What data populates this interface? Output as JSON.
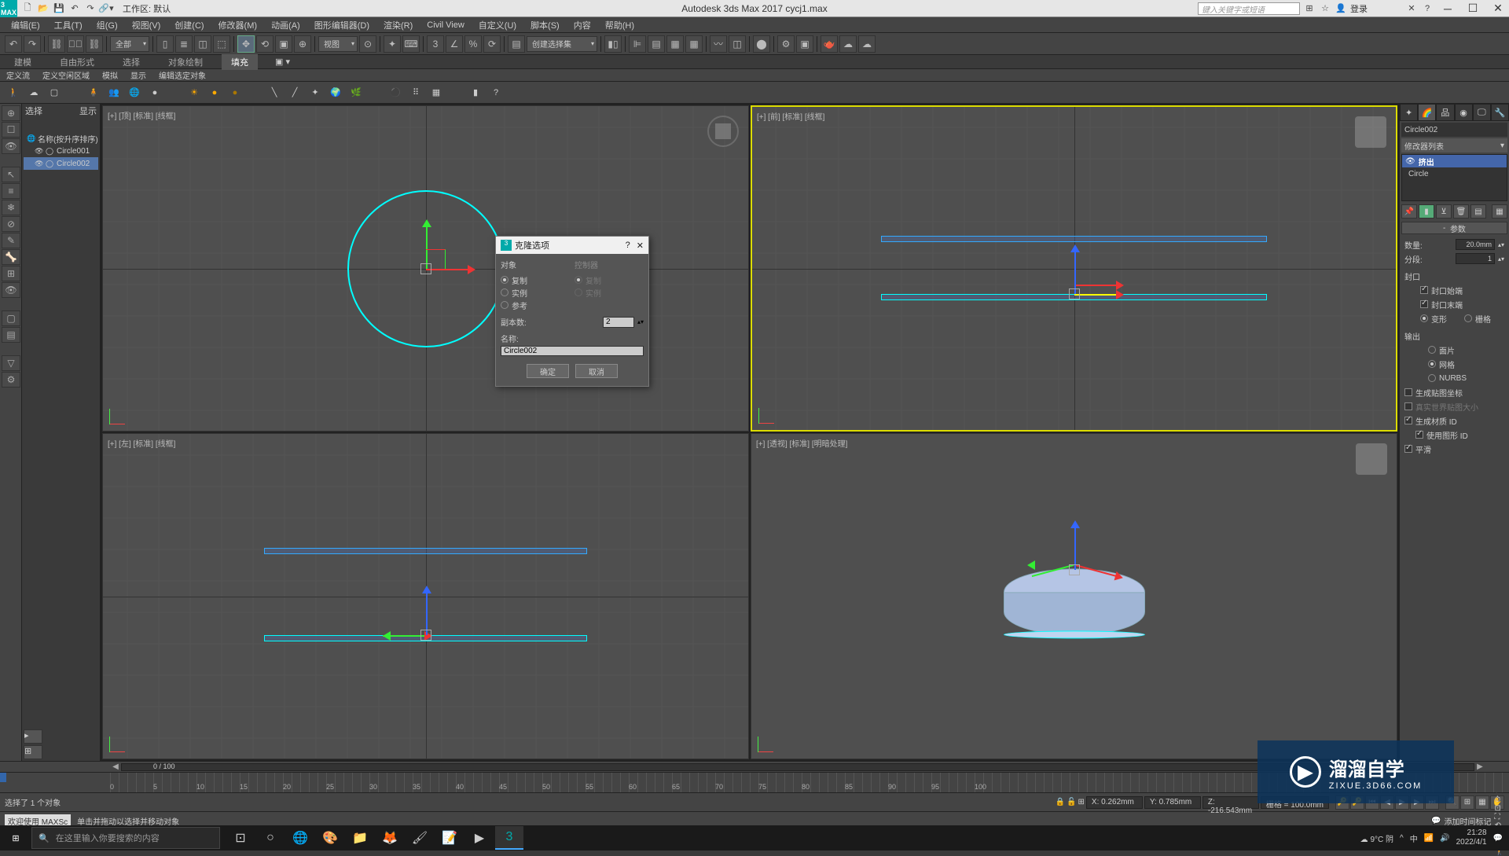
{
  "title": "Autodesk 3ds Max 2017   cycj1.max",
  "workspace": "工作区: 默认",
  "search_placeholder": "键入关键字或短语",
  "login": "登录",
  "menu": [
    "编辑(E)",
    "工具(T)",
    "组(G)",
    "视图(V)",
    "创建(C)",
    "修改器(M)",
    "动画(A)",
    "图形编辑器(D)",
    "渲染(R)",
    "Civil View",
    "自定义(U)",
    "脚本(S)",
    "内容",
    "帮助(H)"
  ],
  "toolbar_combo1": "全部",
  "toolbar_combo2": "视图",
  "toolbar_combo3": "创建选择集",
  "ribbon_tabs": [
    "建模",
    "自由形式",
    "选择",
    "对象绘制",
    "填充"
  ],
  "sub_tabs": [
    "定义流",
    "定义空闲区域",
    "模拟",
    "显示",
    "编辑选定对象"
  ],
  "scene_explorer": {
    "header_toggle": "选择",
    "header_display": "显示",
    "sort_label": "名称(按升序排序)",
    "nodes": [
      "Circle001",
      "Circle002"
    ]
  },
  "viewports": {
    "top": "[+] [顶] [标准] [线框]",
    "front": "[+] [前] [标准] [线框]",
    "left": "[+] [左] [标准] [线框]",
    "persp": "[+] [透视] [标准] [明暗处理]"
  },
  "dialog": {
    "title": "克隆选项",
    "object_label": "对象",
    "controller_label": "控制器",
    "copy": "复制",
    "instance": "实例",
    "reference": "参考",
    "copies_label": "副本数:",
    "copies_value": "2",
    "name_label": "名称:",
    "name_value": "Circle002",
    "ok": "确定",
    "cancel": "取消"
  },
  "cmdpanel": {
    "objname": "Circle002",
    "modlist_label": "修改器列表",
    "stack": [
      "挤出",
      "Circle"
    ],
    "rollout_params": "参数",
    "amount_label": "数量:",
    "amount_value": "20.0mm",
    "segments_label": "分段:",
    "segments_value": "1",
    "cap_label": "封口",
    "cap_start": "封口始端",
    "cap_end": "封口末端",
    "morph": "变形",
    "grid": "栅格",
    "output_label": "输出",
    "patch": "面片",
    "mesh": "网格",
    "nurbs": "NURBS",
    "gen_mapping": "生成贴图坐标",
    "real_world": "真实世界贴图大小",
    "gen_matids": "生成材质 ID",
    "use_shape": "使用图形 ID",
    "smooth": "平滑"
  },
  "timeline": {
    "frame_display": "0 / 100",
    "ticks": [
      "0",
      "5",
      "10",
      "15",
      "20",
      "25",
      "30",
      "35",
      "40",
      "45",
      "50",
      "55",
      "60",
      "65",
      "70",
      "75",
      "80",
      "85",
      "90",
      "95",
      "100"
    ]
  },
  "status": {
    "selection": "选择了 1 个对象",
    "prompt_prefix": "欢迎使用 MAXSc",
    "prompt": "单击并拖动以选择并移动对象",
    "x": "X: 0.262mm",
    "y": "Y: 0.785mm",
    "z": "Z: -216.543mm",
    "grid": "栅格 = 100.0mm",
    "addtime": "添加时间标记"
  },
  "taskbar": {
    "search_placeholder": "在这里输入你要搜索的内容",
    "weather": "9°C 阴",
    "time": "21:28",
    "date": "2022/4/1"
  },
  "watermark": {
    "text": "溜溜自学",
    "url": "ZIXUE.3D66.COM"
  }
}
